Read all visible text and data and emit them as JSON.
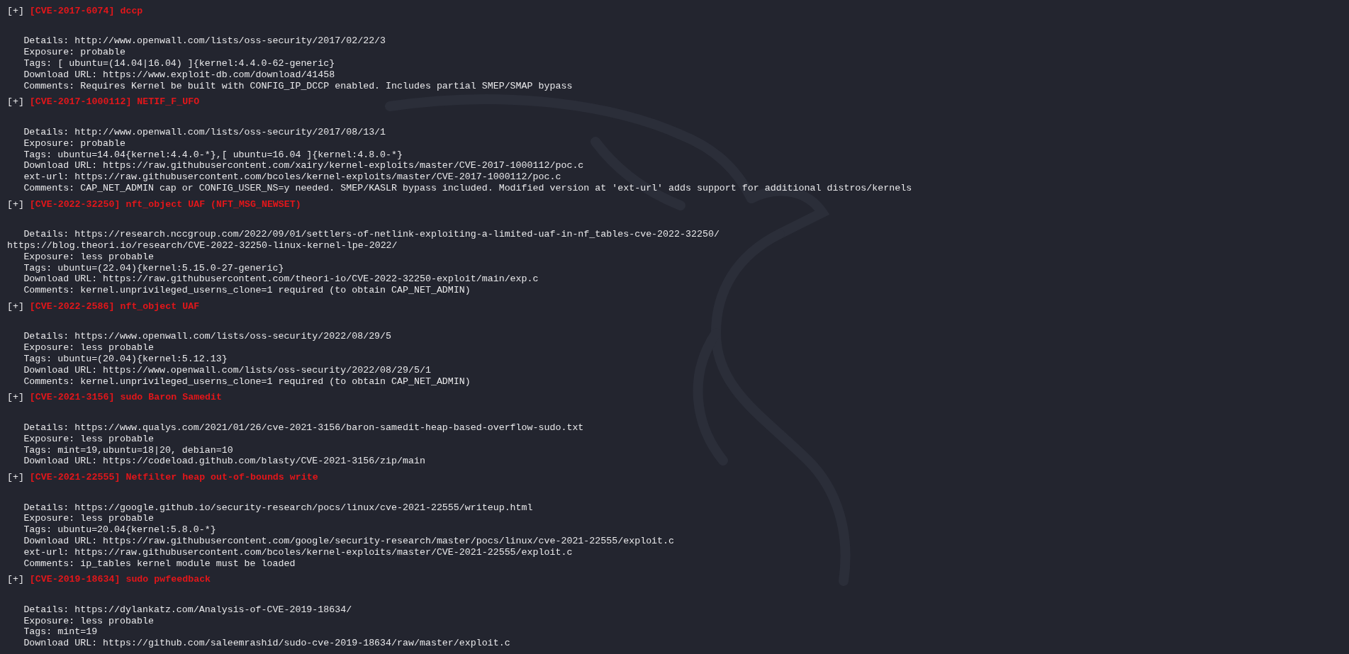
{
  "entries": [
    {
      "marker": "[+]",
      "title": "[CVE-2017-6074] dccp",
      "lines": [
        {
          "text": "Details: http://www.openwall.com/lists/oss-security/2017/02/22/3",
          "indent": true
        },
        {
          "text": "Exposure: probable",
          "indent": true
        },
        {
          "text": "Tags: [ ubuntu=(14.04|16.04) ]{kernel:4.4.0-62-generic}",
          "indent": true
        },
        {
          "text": "Download URL: https://www.exploit-db.com/download/41458",
          "indent": true
        },
        {
          "text": "Comments: Requires Kernel be built with CONFIG_IP_DCCP enabled. Includes partial SMEP/SMAP bypass",
          "indent": true
        }
      ]
    },
    {
      "marker": "[+]",
      "title": "[CVE-2017-1000112] NETIF_F_UFO",
      "lines": [
        {
          "text": "Details: http://www.openwall.com/lists/oss-security/2017/08/13/1",
          "indent": true
        },
        {
          "text": "Exposure: probable",
          "indent": true
        },
        {
          "text": "Tags: ubuntu=14.04{kernel:4.4.0-*},[ ubuntu=16.04 ]{kernel:4.8.0-*}",
          "indent": true
        },
        {
          "text": "Download URL: https://raw.githubusercontent.com/xairy/kernel-exploits/master/CVE-2017-1000112/poc.c",
          "indent": true
        },
        {
          "text": "ext-url: https://raw.githubusercontent.com/bcoles/kernel-exploits/master/CVE-2017-1000112/poc.c",
          "indent": true
        },
        {
          "text": "Comments: CAP_NET_ADMIN cap or CONFIG_USER_NS=y needed. SMEP/KASLR bypass included. Modified version at 'ext-url' adds support for additional distros/kernels",
          "indent": true
        }
      ]
    },
    {
      "marker": "[+]",
      "title": "[CVE-2022-32250] nft_object UAF (NFT_MSG_NEWSET)",
      "lines": [
        {
          "text": "Details: https://research.nccgroup.com/2022/09/01/settlers-of-netlink-exploiting-a-limited-uaf-in-nf_tables-cve-2022-32250/",
          "indent": true
        },
        {
          "text": "https://blog.theori.io/research/CVE-2022-32250-linux-kernel-lpe-2022/",
          "indent": false
        },
        {
          "text": "Exposure: less probable",
          "indent": true
        },
        {
          "text": "Tags: ubuntu=(22.04){kernel:5.15.0-27-generic}",
          "indent": true
        },
        {
          "text": "Download URL: https://raw.githubusercontent.com/theori-io/CVE-2022-32250-exploit/main/exp.c",
          "indent": true
        },
        {
          "text": "Comments: kernel.unprivileged_userns_clone=1 required (to obtain CAP_NET_ADMIN)",
          "indent": true
        }
      ]
    },
    {
      "marker": "[+]",
      "title": "[CVE-2022-2586] nft_object UAF",
      "lines": [
        {
          "text": "Details: https://www.openwall.com/lists/oss-security/2022/08/29/5",
          "indent": true
        },
        {
          "text": "Exposure: less probable",
          "indent": true
        },
        {
          "text": "Tags: ubuntu=(20.04){kernel:5.12.13}",
          "indent": true
        },
        {
          "text": "Download URL: https://www.openwall.com/lists/oss-security/2022/08/29/5/1",
          "indent": true
        },
        {
          "text": "Comments: kernel.unprivileged_userns_clone=1 required (to obtain CAP_NET_ADMIN)",
          "indent": true
        }
      ]
    },
    {
      "marker": "[+]",
      "title": "[CVE-2021-3156] sudo Baron Samedit",
      "lines": [
        {
          "text": "Details: https://www.qualys.com/2021/01/26/cve-2021-3156/baron-samedit-heap-based-overflow-sudo.txt",
          "indent": true
        },
        {
          "text": "Exposure: less probable",
          "indent": true
        },
        {
          "text": "Tags: mint=19,ubuntu=18|20, debian=10",
          "indent": true
        },
        {
          "text": "Download URL: https://codeload.github.com/blasty/CVE-2021-3156/zip/main",
          "indent": true
        }
      ]
    },
    {
      "marker": "[+]",
      "title": "[CVE-2021-22555] Netfilter heap out-of-bounds write",
      "lines": [
        {
          "text": "Details: https://google.github.io/security-research/pocs/linux/cve-2021-22555/writeup.html",
          "indent": true
        },
        {
          "text": "Exposure: less probable",
          "indent": true
        },
        {
          "text": "Tags: ubuntu=20.04{kernel:5.8.0-*}",
          "indent": true
        },
        {
          "text": "Download URL: https://raw.githubusercontent.com/google/security-research/master/pocs/linux/cve-2021-22555/exploit.c",
          "indent": true
        },
        {
          "text": "ext-url: https://raw.githubusercontent.com/bcoles/kernel-exploits/master/CVE-2021-22555/exploit.c",
          "indent": true
        },
        {
          "text": "Comments: ip_tables kernel module must be loaded",
          "indent": true
        }
      ]
    },
    {
      "marker": "[+]",
      "title": "[CVE-2019-18634] sudo pwfeedback",
      "lines": [
        {
          "text": "Details: https://dylankatz.com/Analysis-of-CVE-2019-18634/",
          "indent": true
        },
        {
          "text": "Exposure: less probable",
          "indent": true
        },
        {
          "text": "Tags: mint=19",
          "indent": true
        },
        {
          "text": "Download URL: https://github.com/saleemrashid/sudo-cve-2019-18634/raw/master/exploit.c",
          "indent": true
        }
      ]
    }
  ]
}
